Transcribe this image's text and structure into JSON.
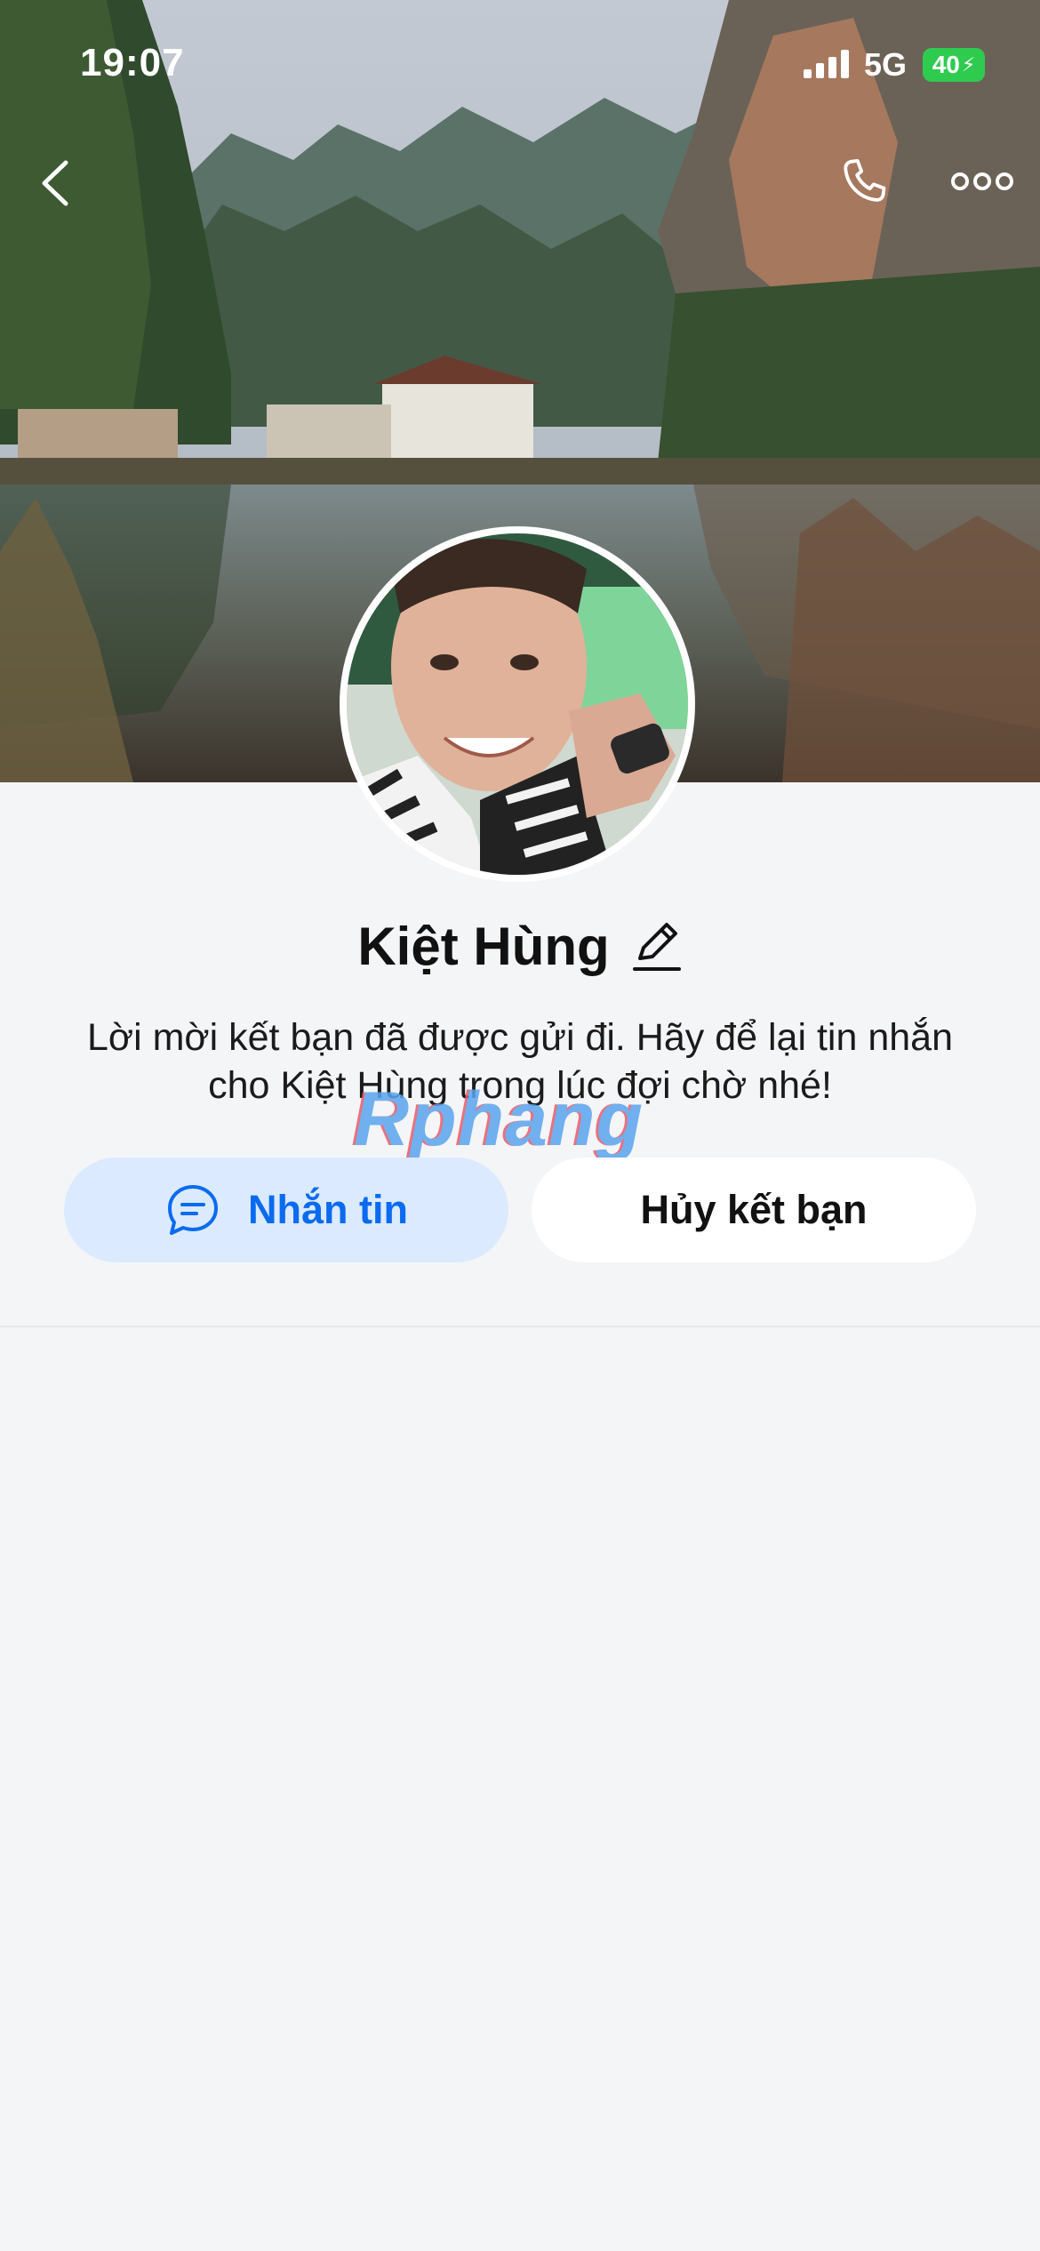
{
  "status_bar": {
    "time": "19:07",
    "network": "5G",
    "battery": "40"
  },
  "profile": {
    "name": "Kiệt Hùng",
    "message": "Lời mời kết bạn đã được gửi đi. Hãy để lại tin nhắn cho Kiệt Hùng trong lúc đợi chờ nhé!"
  },
  "actions": {
    "message_label": "Nhắn tin",
    "cancel_label": "Hủy kết bạn"
  },
  "watermark": "Rphang",
  "colors": {
    "accent": "#0b6bf0",
    "message_button_bg": "#dbeafe",
    "background": "#f4f5f7",
    "battery": "#2fcb4f"
  },
  "icons": [
    "back-icon",
    "phone-icon",
    "more-icon",
    "edit-icon",
    "chat-icon"
  ]
}
